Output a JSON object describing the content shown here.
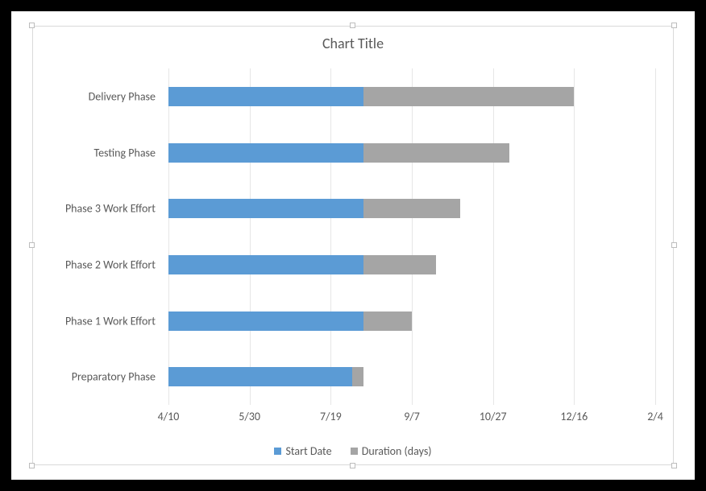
{
  "chart_data": {
    "type": "bar",
    "orientation": "horizontal-stacked",
    "title": "Chart Title",
    "categories_top_to_bottom": [
      "Delivery Phase",
      "Testing Phase",
      "Phase 3 Work Effort",
      "Phase 2 Work Effort",
      "Phase 1 Work Effort",
      "Preparatory Phase"
    ],
    "x_ticks": [
      "4/10",
      "5/30",
      "7/19",
      "9/7",
      "10/27",
      "12/16",
      "2/4"
    ],
    "x_axis_is_dates": true,
    "x_min_serial": 42470,
    "x_max_serial": 42770,
    "series": [
      {
        "name": "Start Date",
        "color": "#5b9bd5",
        "values_serial_by_category": {
          "Preparatory Phase": 42583,
          "Phase 1 Work Effort": 42590,
          "Phase 2 Work Effort": 42590,
          "Phase 3 Work Effort": 42590,
          "Testing Phase": 42590,
          "Delivery Phase": 42590
        },
        "values_date_by_category": {
          "Preparatory Phase": "8/1",
          "Phase 1 Work Effort": "8/8",
          "Phase 2 Work Effort": "8/8",
          "Phase 3 Work Effort": "8/8",
          "Testing Phase": "8/8",
          "Delivery Phase": "8/8"
        }
      },
      {
        "name": "Duration (days)",
        "color": "#a5a5a5",
        "values_by_category": {
          "Preparatory Phase": 7,
          "Phase 1 Work Effort": 30,
          "Phase 2 Work Effort": 45,
          "Phase 3 Work Effort": 60,
          "Testing Phase": 90,
          "Delivery Phase": 130
        }
      }
    ]
  },
  "legend": {
    "item1": "Start Date",
    "item2": "Duration (days)"
  }
}
